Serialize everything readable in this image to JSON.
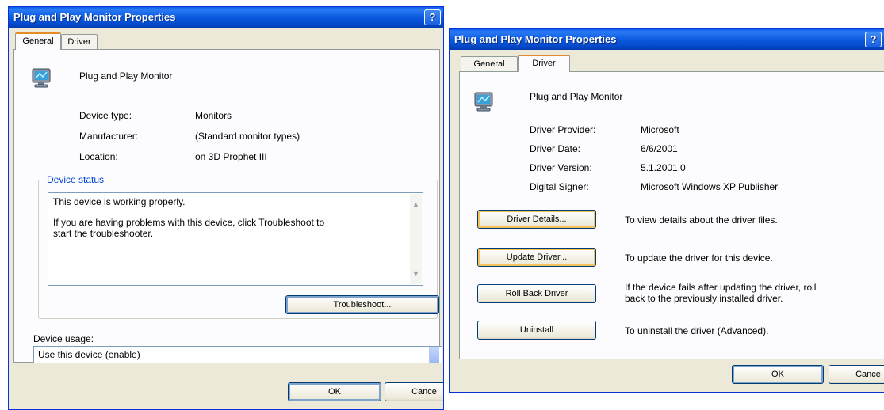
{
  "left": {
    "title": "Plug and Play Monitor Properties",
    "help": "?",
    "tabs": [
      "General",
      "Driver"
    ],
    "device_name": "Plug and Play Monitor",
    "device_icon": "monitor-icon",
    "props": [
      {
        "label": "Device type:",
        "value": "Monitors"
      },
      {
        "label": "Manufacturer:",
        "value": "(Standard monitor types)"
      },
      {
        "label": "Location:",
        "value": "on 3D Prophet III"
      }
    ],
    "status_group": "Device status",
    "status_line1": "This device is working properly.",
    "status_line2": "If you are having problems with this device, click Troubleshoot to",
    "status_line3": "start the troubleshooter.",
    "troubleshoot": "Troubleshoot...",
    "usage_label": "Device usage:",
    "usage_value": "Use this device (enable)",
    "ok": "OK",
    "cancel": "Cance"
  },
  "right": {
    "title": "Plug and Play Monitor Properties",
    "help": "?",
    "tabs": [
      "General",
      "Driver"
    ],
    "device_name": "Plug and Play Monitor",
    "device_icon": "monitor-icon",
    "props": [
      {
        "label": "Driver Provider:",
        "value": "Microsoft"
      },
      {
        "label": "Driver Date:",
        "value": "6/6/2001"
      },
      {
        "label": "Driver Version:",
        "value": "5.1.2001.0"
      },
      {
        "label": "Digital Signer:",
        "value": "Microsoft Windows XP Publisher"
      }
    ],
    "actions": [
      {
        "button": "Driver Details...",
        "desc1": "To view details about the driver files.",
        "desc2": ""
      },
      {
        "button": "Update Driver...",
        "desc1": "To update the driver for this device.",
        "desc2": ""
      },
      {
        "button": "Roll Back Driver",
        "desc1": "If the device fails after updating the driver, roll",
        "desc2": "back to the previously installed driver."
      },
      {
        "button": "Uninstall",
        "desc1": "To uninstall the driver (Advanced).",
        "desc2": ""
      }
    ],
    "ok": "OK",
    "cancel": "Cance"
  }
}
